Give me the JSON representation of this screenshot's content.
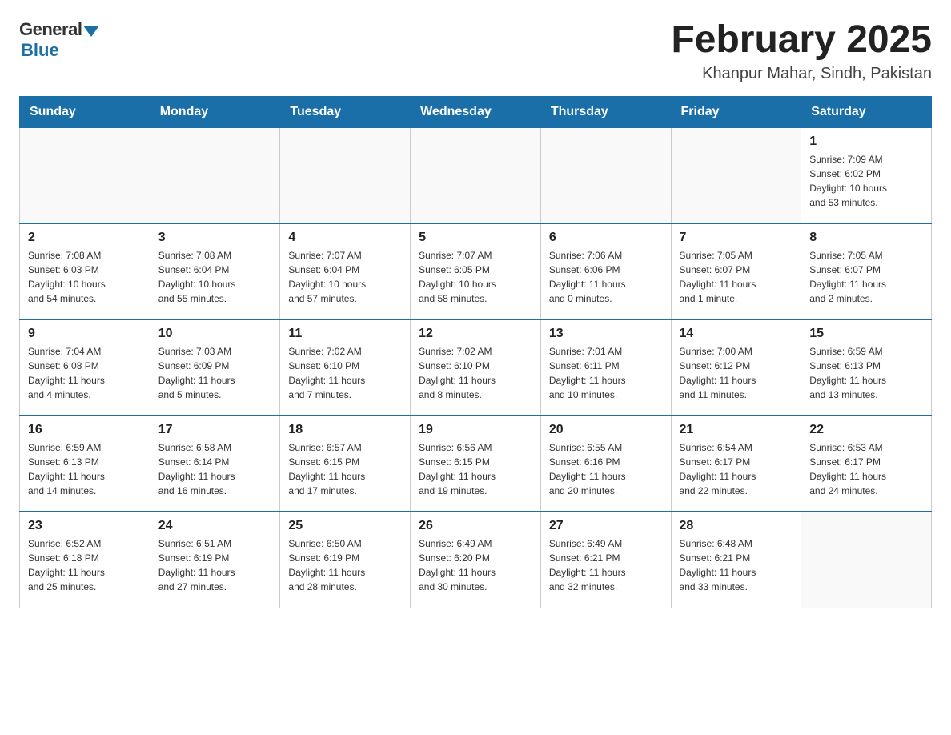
{
  "header": {
    "logo_general": "General",
    "logo_blue": "Blue",
    "month_year": "February 2025",
    "location": "Khanpur Mahar, Sindh, Pakistan"
  },
  "days_of_week": [
    "Sunday",
    "Monday",
    "Tuesday",
    "Wednesday",
    "Thursday",
    "Friday",
    "Saturday"
  ],
  "weeks": [
    [
      {
        "day": "",
        "info": ""
      },
      {
        "day": "",
        "info": ""
      },
      {
        "day": "",
        "info": ""
      },
      {
        "day": "",
        "info": ""
      },
      {
        "day": "",
        "info": ""
      },
      {
        "day": "",
        "info": ""
      },
      {
        "day": "1",
        "info": "Sunrise: 7:09 AM\nSunset: 6:02 PM\nDaylight: 10 hours\nand 53 minutes."
      }
    ],
    [
      {
        "day": "2",
        "info": "Sunrise: 7:08 AM\nSunset: 6:03 PM\nDaylight: 10 hours\nand 54 minutes."
      },
      {
        "day": "3",
        "info": "Sunrise: 7:08 AM\nSunset: 6:04 PM\nDaylight: 10 hours\nand 55 minutes."
      },
      {
        "day": "4",
        "info": "Sunrise: 7:07 AM\nSunset: 6:04 PM\nDaylight: 10 hours\nand 57 minutes."
      },
      {
        "day": "5",
        "info": "Sunrise: 7:07 AM\nSunset: 6:05 PM\nDaylight: 10 hours\nand 58 minutes."
      },
      {
        "day": "6",
        "info": "Sunrise: 7:06 AM\nSunset: 6:06 PM\nDaylight: 11 hours\nand 0 minutes."
      },
      {
        "day": "7",
        "info": "Sunrise: 7:05 AM\nSunset: 6:07 PM\nDaylight: 11 hours\nand 1 minute."
      },
      {
        "day": "8",
        "info": "Sunrise: 7:05 AM\nSunset: 6:07 PM\nDaylight: 11 hours\nand 2 minutes."
      }
    ],
    [
      {
        "day": "9",
        "info": "Sunrise: 7:04 AM\nSunset: 6:08 PM\nDaylight: 11 hours\nand 4 minutes."
      },
      {
        "day": "10",
        "info": "Sunrise: 7:03 AM\nSunset: 6:09 PM\nDaylight: 11 hours\nand 5 minutes."
      },
      {
        "day": "11",
        "info": "Sunrise: 7:02 AM\nSunset: 6:10 PM\nDaylight: 11 hours\nand 7 minutes."
      },
      {
        "day": "12",
        "info": "Sunrise: 7:02 AM\nSunset: 6:10 PM\nDaylight: 11 hours\nand 8 minutes."
      },
      {
        "day": "13",
        "info": "Sunrise: 7:01 AM\nSunset: 6:11 PM\nDaylight: 11 hours\nand 10 minutes."
      },
      {
        "day": "14",
        "info": "Sunrise: 7:00 AM\nSunset: 6:12 PM\nDaylight: 11 hours\nand 11 minutes."
      },
      {
        "day": "15",
        "info": "Sunrise: 6:59 AM\nSunset: 6:13 PM\nDaylight: 11 hours\nand 13 minutes."
      }
    ],
    [
      {
        "day": "16",
        "info": "Sunrise: 6:59 AM\nSunset: 6:13 PM\nDaylight: 11 hours\nand 14 minutes."
      },
      {
        "day": "17",
        "info": "Sunrise: 6:58 AM\nSunset: 6:14 PM\nDaylight: 11 hours\nand 16 minutes."
      },
      {
        "day": "18",
        "info": "Sunrise: 6:57 AM\nSunset: 6:15 PM\nDaylight: 11 hours\nand 17 minutes."
      },
      {
        "day": "19",
        "info": "Sunrise: 6:56 AM\nSunset: 6:15 PM\nDaylight: 11 hours\nand 19 minutes."
      },
      {
        "day": "20",
        "info": "Sunrise: 6:55 AM\nSunset: 6:16 PM\nDaylight: 11 hours\nand 20 minutes."
      },
      {
        "day": "21",
        "info": "Sunrise: 6:54 AM\nSunset: 6:17 PM\nDaylight: 11 hours\nand 22 minutes."
      },
      {
        "day": "22",
        "info": "Sunrise: 6:53 AM\nSunset: 6:17 PM\nDaylight: 11 hours\nand 24 minutes."
      }
    ],
    [
      {
        "day": "23",
        "info": "Sunrise: 6:52 AM\nSunset: 6:18 PM\nDaylight: 11 hours\nand 25 minutes."
      },
      {
        "day": "24",
        "info": "Sunrise: 6:51 AM\nSunset: 6:19 PM\nDaylight: 11 hours\nand 27 minutes."
      },
      {
        "day": "25",
        "info": "Sunrise: 6:50 AM\nSunset: 6:19 PM\nDaylight: 11 hours\nand 28 minutes."
      },
      {
        "day": "26",
        "info": "Sunrise: 6:49 AM\nSunset: 6:20 PM\nDaylight: 11 hours\nand 30 minutes."
      },
      {
        "day": "27",
        "info": "Sunrise: 6:49 AM\nSunset: 6:21 PM\nDaylight: 11 hours\nand 32 minutes."
      },
      {
        "day": "28",
        "info": "Sunrise: 6:48 AM\nSunset: 6:21 PM\nDaylight: 11 hours\nand 33 minutes."
      },
      {
        "day": "",
        "info": ""
      }
    ]
  ]
}
